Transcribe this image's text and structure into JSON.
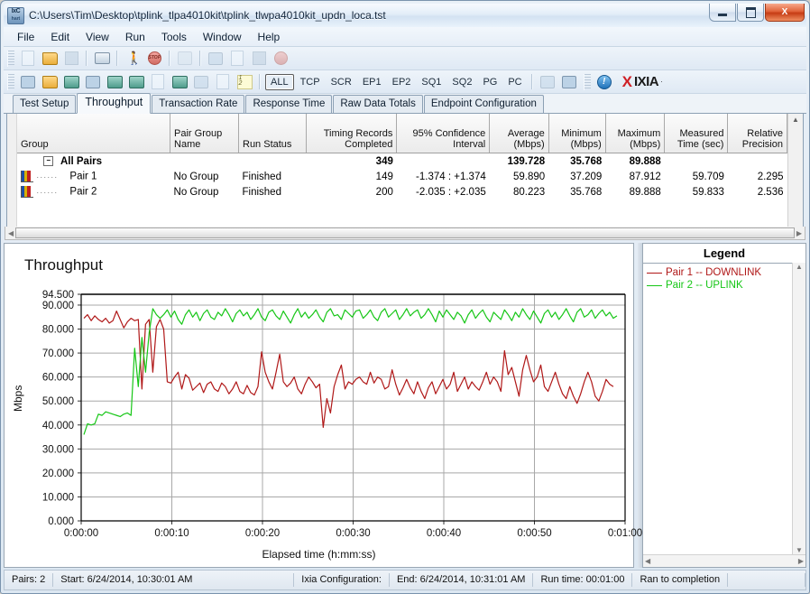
{
  "window": {
    "title": "C:\\Users\\Tim\\Desktop\\tplink_tlpa4010kit\\tplink_tlwpa4010kit_updn_loca.tst",
    "app_icon_line1": "IxC",
    "app_icon_line2": "hart",
    "minimize_label": "Minimize",
    "maximize_label": "Maximize",
    "close_label": "X"
  },
  "menu": {
    "items": [
      {
        "label": "File"
      },
      {
        "label": "Edit"
      },
      {
        "label": "View"
      },
      {
        "label": "Run"
      },
      {
        "label": "Tools"
      },
      {
        "label": "Window"
      },
      {
        "label": "Help"
      }
    ]
  },
  "toolbar2": {
    "filters": [
      "ALL",
      "TCP",
      "SCR",
      "EP1",
      "EP2",
      "SQ1",
      "SQ2",
      "PG",
      "PC"
    ],
    "active_filter": "ALL",
    "brand_x": "X",
    "brand_name": "IXIA",
    "brand_reg": "·"
  },
  "tabs": {
    "items": [
      {
        "label": "Test Setup",
        "selected": false
      },
      {
        "label": "Throughput",
        "selected": true
      },
      {
        "label": "Transaction Rate",
        "selected": false
      },
      {
        "label": "Response Time",
        "selected": false
      },
      {
        "label": "Raw Data Totals",
        "selected": false
      },
      {
        "label": "Endpoint Configuration",
        "selected": false
      }
    ]
  },
  "table": {
    "headers": [
      "Group",
      "Pair Group Name",
      "Run Status",
      "Timing Records Completed",
      "95% Confidence Interval",
      "Average (Mbps)",
      "Minimum (Mbps)",
      "Maximum (Mbps)",
      "Measured Time (sec)",
      "Relative Precision"
    ],
    "rows": [
      {
        "group": "All Pairs",
        "pair_group_name": "",
        "run_status": "",
        "timing_records": "349",
        "confidence": "",
        "average": "139.728",
        "minimum": "35.768",
        "maximum": "89.888",
        "measured_time": "",
        "relative_precision": "",
        "total": true
      },
      {
        "group": "Pair 1",
        "pair_group_name": "No Group",
        "run_status": "Finished",
        "timing_records": "149",
        "confidence": "-1.374 : +1.374",
        "average": "59.890",
        "minimum": "37.209",
        "maximum": "87.912",
        "measured_time": "59.709",
        "relative_precision": "2.295",
        "total": false
      },
      {
        "group": "Pair 2",
        "pair_group_name": "No Group",
        "run_status": "Finished",
        "timing_records": "200",
        "confidence": "-2.035 : +2.035",
        "average": "80.223",
        "minimum": "35.768",
        "maximum": "89.888",
        "measured_time": "59.833",
        "relative_precision": "2.536",
        "total": false
      }
    ]
  },
  "legend": {
    "title": "Legend",
    "items": [
      {
        "label": "Pair 1 -- DOWNLINK",
        "color": "#b01818"
      },
      {
        "label": "Pair 2 -- UPLINK",
        "color": "#16c616"
      }
    ]
  },
  "status": {
    "pairs": "Pairs: 2",
    "start": "Start: 6/24/2014, 10:30:01 AM",
    "config": "Ixia Configuration:",
    "end": "End: 6/24/2014, 10:31:01 AM",
    "runtime": "Run time: 00:01:00",
    "result": "Ran to completion"
  },
  "chart_data": {
    "type": "line",
    "title": "Throughput",
    "xlabel": "Elapsed time (h:mm:ss)",
    "ylabel": "Mbps",
    "ylim": [
      0,
      94.5
    ],
    "yticks": [
      0.0,
      10.0,
      20.0,
      30.0,
      40.0,
      50.0,
      60.0,
      70.0,
      80.0,
      90.0,
      94.5
    ],
    "ytick_labels": [
      "0.000",
      "10.000",
      "20.000",
      "30.000",
      "40.000",
      "50.000",
      "60.000",
      "70.000",
      "80.000",
      "90.000",
      "94.500"
    ],
    "xlim": [
      0,
      60
    ],
    "xticks": [
      0,
      10,
      20,
      30,
      40,
      50,
      60
    ],
    "xtick_labels": [
      "0:00:00",
      "0:00:10",
      "0:00:20",
      "0:00:30",
      "0:00:40",
      "0:00:50",
      "0:01:00"
    ],
    "grid": true,
    "legend_position": "right",
    "series": [
      {
        "name": "Pair 1 -- DOWNLINK",
        "color": "#b01818",
        "x": [
          0.3,
          0.7,
          1.1,
          1.5,
          1.9,
          2.3,
          2.7,
          3.1,
          3.5,
          3.9,
          4.3,
          4.7,
          5.1,
          5.5,
          5.9,
          6.3,
          6.7,
          7.1,
          7.5,
          7.9,
          8.3,
          8.7,
          9.1,
          9.5,
          9.9,
          10.3,
          10.7,
          11.1,
          11.5,
          11.9,
          12.3,
          12.7,
          13.1,
          13.5,
          13.9,
          14.3,
          14.7,
          15.1,
          15.5,
          15.9,
          16.3,
          16.7,
          17.1,
          17.5,
          17.9,
          18.3,
          18.7,
          19.1,
          19.5,
          19.9,
          20.3,
          20.7,
          21.1,
          21.5,
          21.9,
          22.3,
          22.7,
          23.1,
          23.5,
          23.9,
          24.3,
          24.7,
          25.1,
          25.5,
          25.9,
          26.3,
          26.7,
          27.1,
          27.5,
          27.9,
          28.3,
          28.7,
          29.1,
          29.5,
          29.9,
          30.3,
          30.7,
          31.1,
          31.5,
          31.9,
          32.3,
          32.7,
          33.1,
          33.5,
          33.9,
          34.3,
          34.7,
          35.1,
          35.5,
          35.9,
          36.3,
          36.7,
          37.1,
          37.5,
          37.9,
          38.3,
          38.7,
          39.1,
          39.5,
          39.9,
          40.3,
          40.7,
          41.1,
          41.5,
          41.9,
          42.3,
          42.7,
          43.1,
          43.5,
          43.9,
          44.3,
          44.7,
          45.1,
          45.5,
          45.9,
          46.3,
          46.7,
          47.1,
          47.5,
          47.9,
          48.3,
          48.7,
          49.1,
          49.5,
          49.9,
          50.3,
          50.7,
          51.1,
          51.5,
          51.9,
          52.3,
          52.7,
          53.1,
          53.5,
          53.9,
          54.3,
          54.7,
          55.1,
          55.5,
          55.9,
          56.3,
          56.7,
          57.1,
          57.5,
          57.9,
          58.3,
          58.7,
          59.1,
          59.5,
          59.9
        ],
        "y": [
          84.5,
          86.0,
          83.5,
          85.5,
          84.0,
          83.0,
          84.5,
          82.5,
          83.5,
          87.5,
          84.0,
          80.5,
          83.0,
          84.5,
          83.5,
          84.0,
          55.0,
          82.0,
          84.0,
          62.0,
          81.0,
          84.0,
          80.0,
          58.0,
          57.5,
          60.0,
          62.0,
          55.0,
          61.0,
          59.5,
          54.5,
          56.0,
          57.5,
          53.5,
          57.0,
          58.0,
          55.0,
          54.0,
          57.5,
          56.0,
          53.0,
          55.0,
          58.0,
          54.0,
          53.0,
          56.5,
          53.5,
          52.5,
          56.0,
          70.5,
          62.0,
          58.0,
          55.0,
          62.0,
          69.5,
          58.0,
          56.0,
          57.5,
          60.0,
          55.0,
          53.0,
          57.0,
          60.0,
          58.0,
          55.5,
          57.0,
          39.0,
          51.0,
          45.0,
          56.0,
          61.0,
          65.0,
          55.0,
          58.0,
          57.0,
          59.0,
          60.0,
          58.0,
          57.0,
          62.0,
          57.5,
          60.0,
          59.0,
          55.0,
          56.0,
          63.0,
          57.0,
          52.5,
          55.5,
          59.0,
          55.5,
          53.0,
          58.0,
          54.0,
          51.0,
          55.5,
          58.0,
          53.0,
          56.0,
          59.0,
          55.0,
          57.0,
          62.0,
          54.0,
          57.0,
          60.0,
          55.0,
          58.0,
          56.0,
          54.5,
          58.0,
          62.0,
          57.0,
          60.0,
          58.0,
          54.0,
          71.0,
          61.0,
          64.0,
          58.0,
          52.0,
          63.0,
          69.0,
          63.0,
          58.0,
          60.0,
          65.0,
          56.0,
          54.0,
          58.0,
          62.0,
          57.0,
          53.0,
          51.0,
          56.0,
          52.0,
          49.0,
          53.0,
          58.0,
          62.0,
          58.0,
          52.0,
          50.0,
          54.0,
          59.0,
          57.0,
          56.0
        ]
      },
      {
        "name": "Pair 2 -- UPLINK",
        "color": "#16c616",
        "x": [
          0.3,
          0.7,
          1.1,
          1.5,
          1.9,
          2.3,
          2.7,
          3.1,
          3.5,
          3.9,
          4.3,
          4.7,
          5.1,
          5.5,
          5.9,
          6.3,
          6.7,
          7.1,
          7.5,
          7.9,
          8.3,
          8.7,
          9.1,
          9.5,
          9.9,
          10.3,
          10.7,
          11.1,
          11.5,
          11.9,
          12.3,
          12.7,
          13.1,
          13.5,
          13.9,
          14.3,
          14.7,
          15.1,
          15.5,
          15.9,
          16.3,
          16.7,
          17.1,
          17.5,
          17.9,
          18.3,
          18.7,
          19.1,
          19.5,
          19.9,
          20.3,
          20.7,
          21.1,
          21.5,
          21.9,
          22.3,
          22.7,
          23.1,
          23.5,
          23.9,
          24.3,
          24.7,
          25.1,
          25.5,
          25.9,
          26.3,
          26.7,
          27.1,
          27.5,
          27.9,
          28.3,
          28.7,
          29.1,
          29.5,
          29.9,
          30.3,
          30.7,
          31.1,
          31.5,
          31.9,
          32.3,
          32.7,
          33.1,
          33.5,
          33.9,
          34.3,
          34.7,
          35.1,
          35.5,
          35.9,
          36.3,
          36.7,
          37.1,
          37.5,
          37.9,
          38.3,
          38.7,
          39.1,
          39.5,
          39.9,
          40.3,
          40.7,
          41.1,
          41.5,
          41.9,
          42.3,
          42.7,
          43.1,
          43.5,
          43.9,
          44.3,
          44.7,
          45.1,
          45.5,
          45.9,
          46.3,
          46.7,
          47.1,
          47.5,
          47.9,
          48.3,
          48.7,
          49.1,
          49.5,
          49.9,
          50.3,
          50.7,
          51.1,
          51.5,
          51.9,
          52.3,
          52.7,
          53.1,
          53.5,
          53.9,
          54.3,
          54.7,
          55.1,
          55.5,
          55.9,
          56.3,
          56.7,
          57.1,
          57.5,
          57.9,
          58.3,
          58.7,
          59.1,
          59.5,
          59.9
        ],
        "y": [
          36.0,
          40.5,
          40.0,
          40.5,
          44.5,
          44.0,
          45.5,
          45.0,
          44.5,
          44.0,
          43.5,
          44.5,
          45.0,
          44.0,
          72.0,
          56.0,
          76.5,
          62.0,
          78.5,
          88.5,
          86.0,
          84.5,
          86.0,
          88.0,
          85.0,
          87.5,
          84.0,
          82.0,
          86.0,
          88.0,
          85.0,
          87.0,
          83.5,
          86.5,
          88.0,
          85.0,
          84.0,
          87.0,
          85.5,
          88.5,
          86.0,
          83.0,
          86.5,
          88.0,
          85.5,
          87.0,
          84.0,
          86.0,
          88.5,
          85.0,
          83.5,
          87.0,
          88.0,
          85.5,
          84.0,
          87.5,
          85.0,
          82.5,
          86.0,
          88.5,
          85.0,
          87.0,
          84.5,
          86.0,
          88.0,
          85.0,
          83.0,
          87.0,
          88.5,
          85.5,
          86.0,
          84.0,
          88.0,
          86.5,
          85.0,
          87.5,
          88.0,
          84.5,
          86.0,
          88.0,
          85.0,
          83.5,
          87.0,
          88.5,
          85.0,
          86.5,
          88.0,
          84.0,
          86.0,
          88.5,
          85.5,
          87.0,
          88.0,
          84.5,
          86.0,
          88.5,
          86.0,
          83.0,
          87.5,
          85.0,
          88.0,
          86.0,
          84.0,
          87.0,
          85.5,
          82.5,
          86.0,
          88.0,
          84.5,
          86.5,
          88.0,
          85.0,
          83.0,
          87.0,
          85.5,
          84.0,
          88.0,
          86.0,
          83.5,
          87.0,
          85.0,
          88.5,
          86.0,
          84.0,
          87.5,
          85.0,
          82.5,
          86.5,
          88.0,
          85.0,
          87.0,
          84.0,
          86.0,
          88.5,
          85.5,
          83.0,
          87.0,
          88.5,
          85.0,
          86.0,
          88.0,
          84.5,
          86.5,
          88.0,
          85.5,
          87.0,
          84.5,
          85.5
        ]
      }
    ]
  }
}
